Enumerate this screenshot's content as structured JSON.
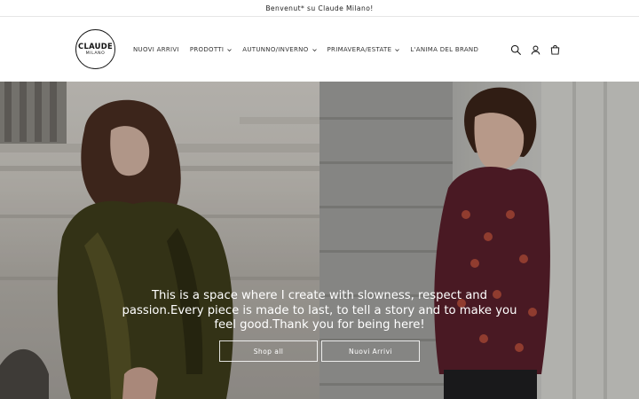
{
  "announcement": {
    "text": "Benvenut* su Claude Milano!"
  },
  "logo": {
    "line1": "CLAUDE",
    "line2": "MILANO"
  },
  "nav": {
    "items": [
      {
        "label": "NUOVI ARRIVI",
        "dropdown": false
      },
      {
        "label": "PRODOTTI",
        "dropdown": true
      },
      {
        "label": "AUTUNNO/INVERNO",
        "dropdown": true
      },
      {
        "label": "PRIMAVERA/ESTATE",
        "dropdown": true
      },
      {
        "label": "L'ANIMA DEL BRAND",
        "dropdown": false
      }
    ]
  },
  "header_icons": [
    "search-icon",
    "account-icon",
    "cart-icon"
  ],
  "hero": {
    "text": "This is a space where I create with slowness, respect and passion.Every piece is made to last, to tell a story and to make you feel good.Thank you for being here!",
    "buttons": {
      "shop_all": "Shop all",
      "new_arrivals": "Nuovi Arrivi"
    }
  },
  "colors": {
    "text": "#121212",
    "background": "#ffffff",
    "button_border": "#ffffff"
  }
}
